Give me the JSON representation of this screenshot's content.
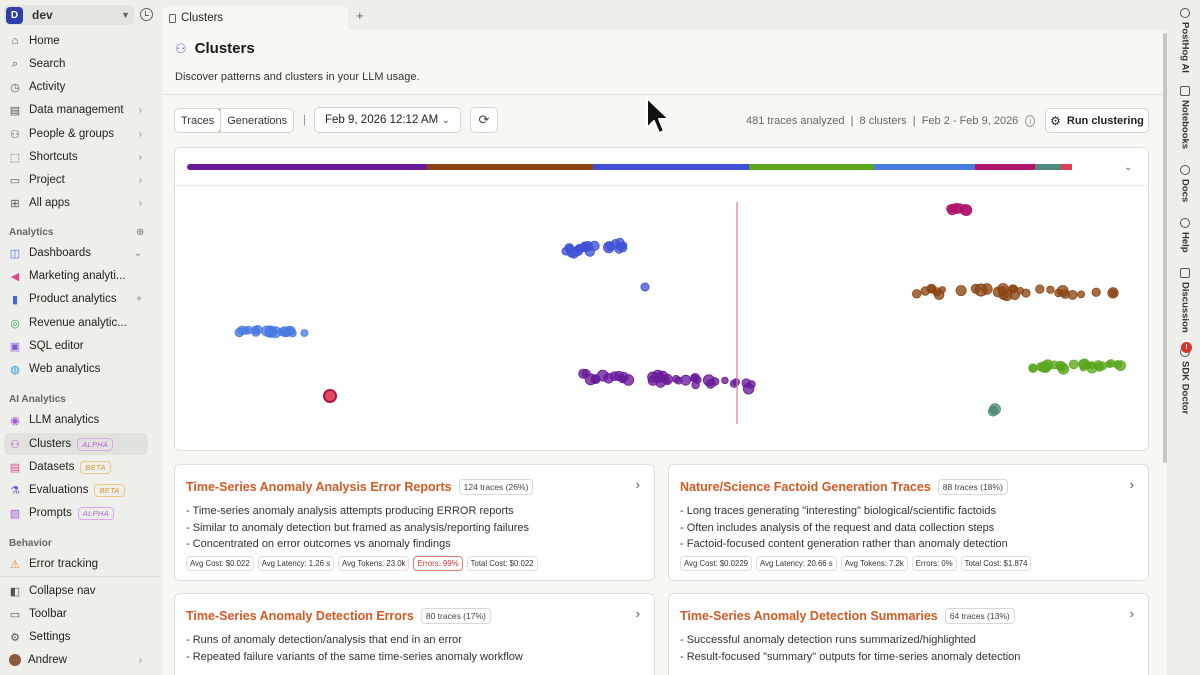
{
  "project": {
    "initial": "D",
    "name": "dev"
  },
  "nav": {
    "top": [
      {
        "label": "Home",
        "icon": "home-icon"
      },
      {
        "label": "Search",
        "icon": "search-icon"
      },
      {
        "label": "Activity",
        "icon": "activity-icon"
      },
      {
        "label": "Data management",
        "icon": "database-icon"
      },
      {
        "label": "People & groups",
        "icon": "people-icon"
      },
      {
        "label": "Shortcuts",
        "icon": "shortcut-icon"
      },
      {
        "label": "Project",
        "icon": "folder-icon"
      },
      {
        "label": "All apps",
        "icon": "apps-icon"
      }
    ],
    "analytics_heading": "Analytics",
    "analytics": [
      {
        "label": "Dashboards"
      },
      {
        "label": "Marketing analyti..."
      },
      {
        "label": "Product analytics"
      },
      {
        "label": "Revenue analytic..."
      },
      {
        "label": "SQL editor"
      },
      {
        "label": "Web analytics"
      }
    ],
    "ai_heading": "AI Analytics",
    "ai": [
      {
        "label": "LLM analytics"
      },
      {
        "label": "Clusters",
        "badge": "ALPHA"
      },
      {
        "label": "Datasets",
        "badge": "BETA"
      },
      {
        "label": "Evaluations",
        "badge": "BETA"
      },
      {
        "label": "Prompts",
        "badge": "ALPHA"
      }
    ],
    "behavior_heading": "Behavior",
    "behavior": [
      {
        "label": "Error tracking"
      }
    ],
    "bottom": [
      {
        "label": "Collapse nav"
      },
      {
        "label": "Toolbar"
      },
      {
        "label": "Settings"
      },
      {
        "label": "Andrew"
      }
    ]
  },
  "tab": {
    "label": "Clusters"
  },
  "page": {
    "title": "Clusters",
    "subtitle": "Discover patterns and clusters in your LLM usage."
  },
  "toolbar": {
    "seg_traces": "Traces",
    "seg_generations": "Generations",
    "separator": "|",
    "date": "Feb 9, 2026 12:12 AM",
    "stats": "481 traces analyzed  |  8 clusters  |  Feb 2 - Feb 9, 2026",
    "run_label": "Run clustering"
  },
  "distribution": [
    {
      "color": "#6a1b9a",
      "share": 0.26
    },
    {
      "color": "#8b4513",
      "share": 0.18
    },
    {
      "color": "#3f51d6",
      "share": 0.17
    },
    {
      "color": "#5aa71e",
      "share": 0.135
    },
    {
      "color": "#4a7be0",
      "share": 0.11
    },
    {
      "color": "#b0156b",
      "share": 0.065
    },
    {
      "color": "#4f8b7c",
      "share": 0.028
    },
    {
      "color": "#e03d58",
      "share": 0.012
    }
  ],
  "scatter_clusters": [
    {
      "color": "#6a1b9a"
    },
    {
      "color": "#8b4513"
    },
    {
      "color": "#3f51d6"
    },
    {
      "color": "#5aa71e"
    },
    {
      "color": "#4a7be0"
    },
    {
      "color": "#b0156b"
    },
    {
      "color": "#4f8b7c"
    },
    {
      "color": "#e03d58"
    }
  ],
  "cards": [
    {
      "title": "Time-Series Anomaly Analysis Error Reports",
      "badge": "124 traces (26%)",
      "bullets": [
        "- Time-series anomaly analysis attempts producing ERROR reports",
        "- Similar to anomaly detection but framed as analysis/reporting failures",
        "- Concentrated on error outcomes vs anomaly findings"
      ],
      "metrics": [
        "Avg Cost: $0.022",
        "Avg Latency: 1.26 s",
        "Avg Tokens: 23.0k",
        "Errors: 99%",
        "Total Cost: $0.022"
      ],
      "error_index": 3
    },
    {
      "title": "Nature/Science Factoid Generation Traces",
      "badge": "88 traces (18%)",
      "bullets": [
        "- Long traces generating \"interesting\" biological/scientific factoids",
        "- Often includes analysis of the request and data collection steps",
        "- Factoid-focused content generation rather than anomaly detection"
      ],
      "metrics": [
        "Avg Cost: $0.0229",
        "Avg Latency: 20.66 s",
        "Avg Tokens: 7.2k",
        "Errors: 0%",
        "Total Cost: $1.874"
      ],
      "error_index": -1
    },
    {
      "title": "Time-Series Anomaly Detection Errors",
      "badge": "80 traces (17%)",
      "bullets": [
        "- Runs of anomaly detection/analysis that end in an error",
        "- Repeated failure variants of the same time-series anomaly workflow"
      ],
      "metrics": [],
      "error_index": -1
    },
    {
      "title": "Time-Series Anomaly Detection Summaries",
      "badge": "64 traces (13%)",
      "bullets": [
        "- Successful anomaly detection runs summarized/highlighted",
        "- Result-focused \"summary\" outputs for time-series anomaly detection"
      ],
      "metrics": [],
      "error_index": -1
    }
  ],
  "rail": [
    {
      "label": "PostHog AI",
      "icon": "posthog-ai-icon"
    },
    {
      "label": "Notebooks",
      "icon": "notebook-icon"
    },
    {
      "label": "Docs",
      "icon": "info-icon"
    },
    {
      "label": "Help",
      "icon": "help-icon"
    },
    {
      "label": "Discussion",
      "icon": "discussion-icon"
    },
    {
      "label": "SDK Doctor",
      "icon": "sdk-doctor-icon",
      "alert": "!"
    }
  ]
}
